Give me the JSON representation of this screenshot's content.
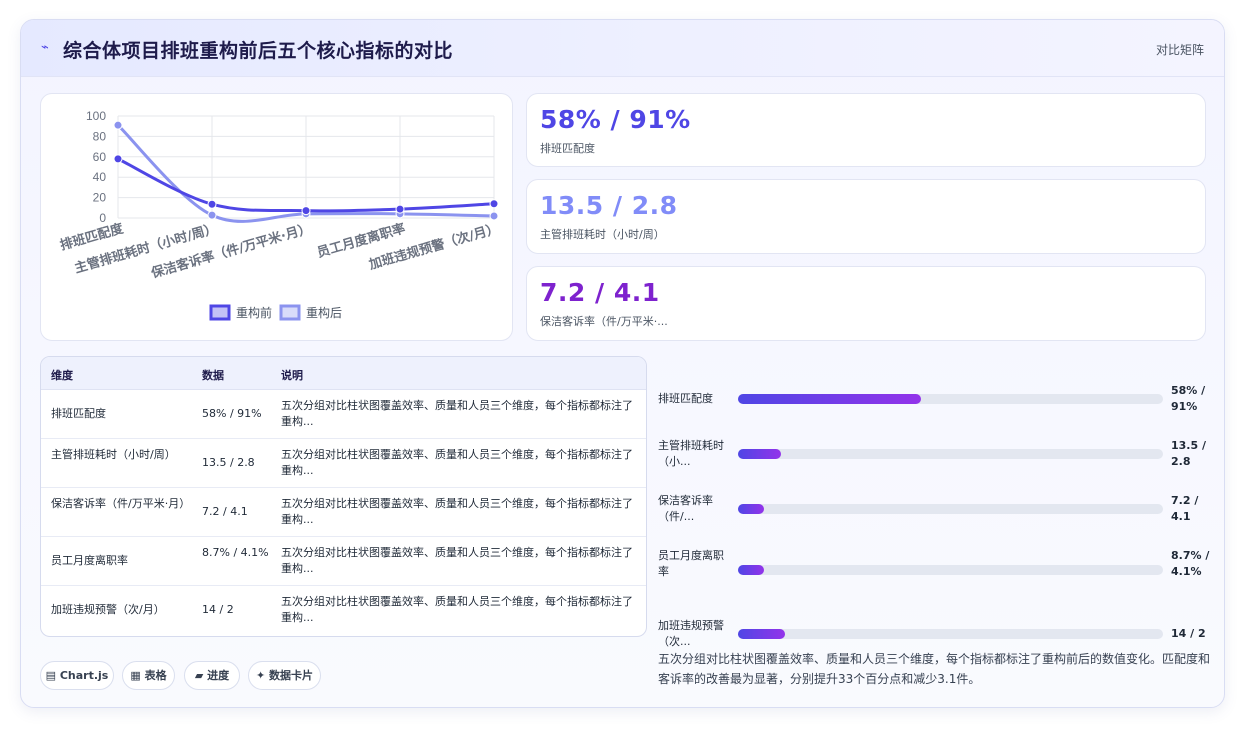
{
  "header": {
    "icon": "trend-line-icon",
    "icon_glyph": "⌁",
    "title": "综合体项目排班重构前后五个核心指标的对比",
    "link": "对比矩阵"
  },
  "chart_data": {
    "type": "line",
    "categories": [
      "排班匹配度",
      "主管排班耗时（小时/周）",
      "保洁客诉率（件/万平米·月）",
      "员工月度离职率",
      "加班违规预警（次/月）"
    ],
    "series": [
      {
        "name": "重构前",
        "values": [
          58,
          13.5,
          7.2,
          8.7,
          14
        ],
        "color": "#4f46e5"
      },
      {
        "name": "重构后",
        "values": [
          91,
          2.8,
          4.1,
          4.1,
          2
        ],
        "color": "#8b93ef"
      }
    ],
    "yticks": [
      "100",
      "80",
      "60",
      "40",
      "20",
      "0"
    ],
    "ylim": [
      0,
      100
    ],
    "grid": true,
    "legend": "bottom"
  },
  "stats": [
    {
      "value": "58% / 91%",
      "label": "排班匹配度",
      "color": "#4f46e5"
    },
    {
      "value": "13.5 / 2.8",
      "label": "主管排班耗时（小时/周）",
      "color": "#818cf8"
    },
    {
      "value": "7.2 / 4.1",
      "label": "保洁客诉率（件/万平米·...",
      "color": "#7e22ce"
    }
  ],
  "table": {
    "headers": [
      "维度",
      "数据",
      "说明"
    ],
    "rows": [
      {
        "dim": "排班匹配度",
        "data": "58% / 91%",
        "note": "五次分组对比柱状图覆盖效率、质量和人员三个维度，每个指标都标注了重构..."
      },
      {
        "dim": "主管排班耗时（小时/周）",
        "data": "13.5 / 2.8",
        "note": "五次分组对比柱状图覆盖效率、质量和人员三个维度，每个指标都标注了重构..."
      },
      {
        "dim": "保洁客诉率（件/万平米·月）",
        "data": "7.2 / 4.1",
        "note": "五次分组对比柱状图覆盖效率、质量和人员三个维度，每个指标都标注了重构..."
      },
      {
        "dim": "员工月度离职率",
        "data": "8.7% / 4.1%",
        "note": "五次分组对比柱状图覆盖效率、质量和人员三个维度，每个指标都标注了重构..."
      },
      {
        "dim": "加班违规预警（次/月）",
        "data": "14 / 2",
        "note": "五次分组对比柱状图覆盖效率、质量和人员三个维度，每个指标都标注了重构..."
      }
    ]
  },
  "progress": [
    {
      "label": "排班匹配度",
      "value": "58% / 91%",
      "fill": 0.43
    },
    {
      "label": "主管排班耗时（小...",
      "value": "13.5 / 2.8",
      "fill": 0.1
    },
    {
      "label": "保洁客诉率（件/...",
      "value": "7.2 / 4.1",
      "fill": 0.06
    },
    {
      "label": "员工月度离职率",
      "value": "8.7% / 4.1%",
      "fill": 0.06
    },
    {
      "label": "加班违规预警（次...",
      "value": "14 / 2",
      "fill": 0.11
    }
  ],
  "summary": "五次分组对比柱状图覆盖效率、质量和人员三个维度，每个指标都标注了重构前后的数值变化。匹配度和客诉率的改善最为显著，分别提升33个百分点和减少3.1件。",
  "chips": [
    {
      "label": "▤ Chart.js",
      "icon": "chart-icon"
    },
    {
      "label": "▦ 表格",
      "icon": "table-icon"
    },
    {
      "label": "▰ 进度",
      "icon": "progress-icon"
    },
    {
      "label": "✦ 数据卡片",
      "icon": "sparkle-icon"
    }
  ]
}
